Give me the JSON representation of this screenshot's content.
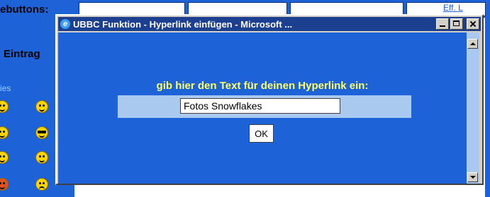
{
  "background_page": {
    "left_heading_top": "ebuttons:",
    "left_heading_entry": "Eintrag",
    "left_label": "ies",
    "right_link": "Eff. L",
    "smileys": [
      "grin-icon",
      "laugh-icon",
      "wink-icon",
      "cool-icon",
      "happy-icon",
      "surprised-icon",
      "tongue-icon",
      "sad-icon"
    ]
  },
  "window": {
    "title": "UBBC Funktion - Hyperlink einfügen - Microsoft ...",
    "prompt": "gib hier den Text für deinen Hyperlink ein:",
    "input_value": "Fotos Snowflakes",
    "ok_label": "OK"
  },
  "colors": {
    "page_blue": "#1d62d6",
    "prompt_yellow": "#ffff66",
    "light_blue": "#a9c9ee",
    "title_bar": "#1d3f90"
  }
}
